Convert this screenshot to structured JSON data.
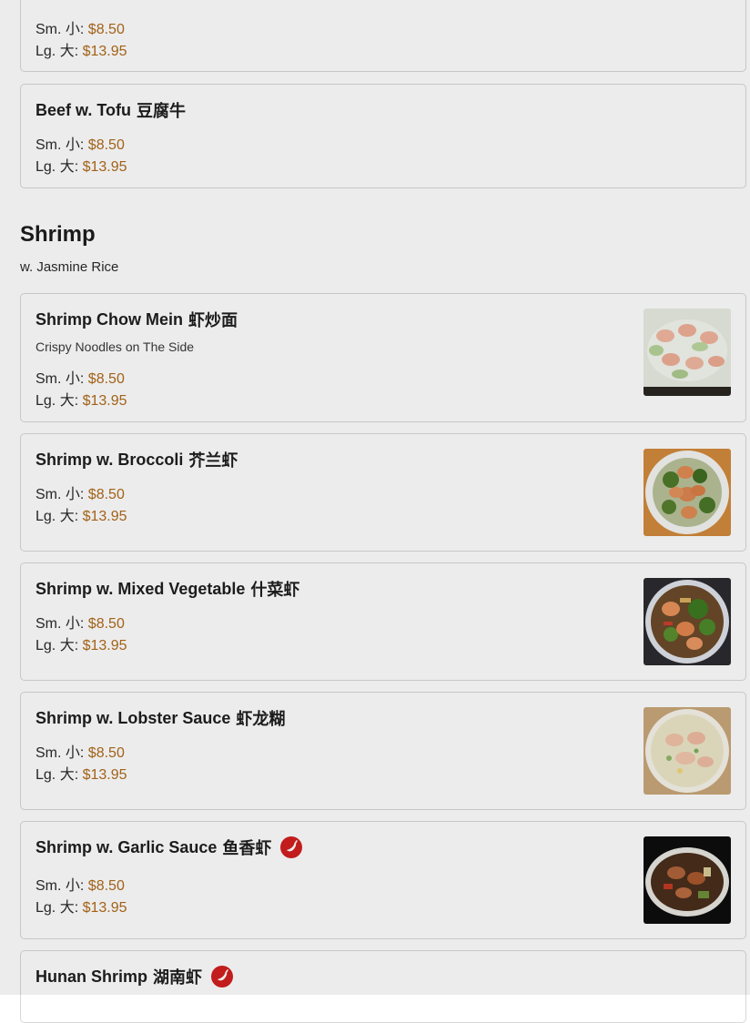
{
  "colors": {
    "price": "#b06a1a",
    "spicy": "#d21f1f",
    "border": "#d8d8d8"
  },
  "partial_item": {
    "small_label": "Sm. 小:",
    "small_price": "$8.50",
    "large_label": "Lg. 大:",
    "large_price": "$13.95"
  },
  "items": [
    {
      "name": "Beef w. Tofu",
      "hanzi": "豆腐牛",
      "small_label": "Sm. 小:",
      "small_price": "$8.50",
      "large_label": "Lg. 大:",
      "large_price": "$13.95"
    },
    {
      "name": "Shrimp Chow Mein",
      "hanzi": "虾炒面",
      "description": "Crispy Noodles on The Side",
      "small_label": "Sm. 小:",
      "small_price": "$8.50",
      "large_label": "Lg. 大:",
      "large_price": "$13.95",
      "image": "shrimp-chow-mein-photo"
    },
    {
      "name": "Shrimp w. Broccoli",
      "hanzi": "芥兰虾",
      "small_label": "Sm. 小:",
      "small_price": "$8.50",
      "large_label": "Lg. 大:",
      "large_price": "$13.95",
      "image": "shrimp-broccoli-photo"
    },
    {
      "name": "Shrimp w. Mixed Vegetable",
      "hanzi": "什菜虾",
      "small_label": "Sm. 小:",
      "small_price": "$8.50",
      "large_label": "Lg. 大:",
      "large_price": "$13.95",
      "image": "shrimp-mixed-vegetable-photo"
    },
    {
      "name": "Shrimp w. Lobster Sauce",
      "hanzi": "虾龙糊",
      "small_label": "Sm. 小:",
      "small_price": "$8.50",
      "large_label": "Lg. 大:",
      "large_price": "$13.95",
      "image": "shrimp-lobster-sauce-photo"
    },
    {
      "name": "Shrimp w. Garlic Sauce",
      "hanzi": "鱼香虾",
      "small_label": "Sm. 小:",
      "small_price": "$8.50",
      "large_label": "Lg. 大:",
      "large_price": "$13.95",
      "image": "shrimp-garlic-sauce-photo",
      "spicy": true
    },
    {
      "name": "Hunan Shrimp",
      "hanzi": "湖南虾",
      "spicy": true
    }
  ],
  "section": {
    "title": "Shrimp",
    "subtitle": "w. Jasmine Rice"
  },
  "icons": {
    "spicy": "chili-pepper-icon"
  }
}
